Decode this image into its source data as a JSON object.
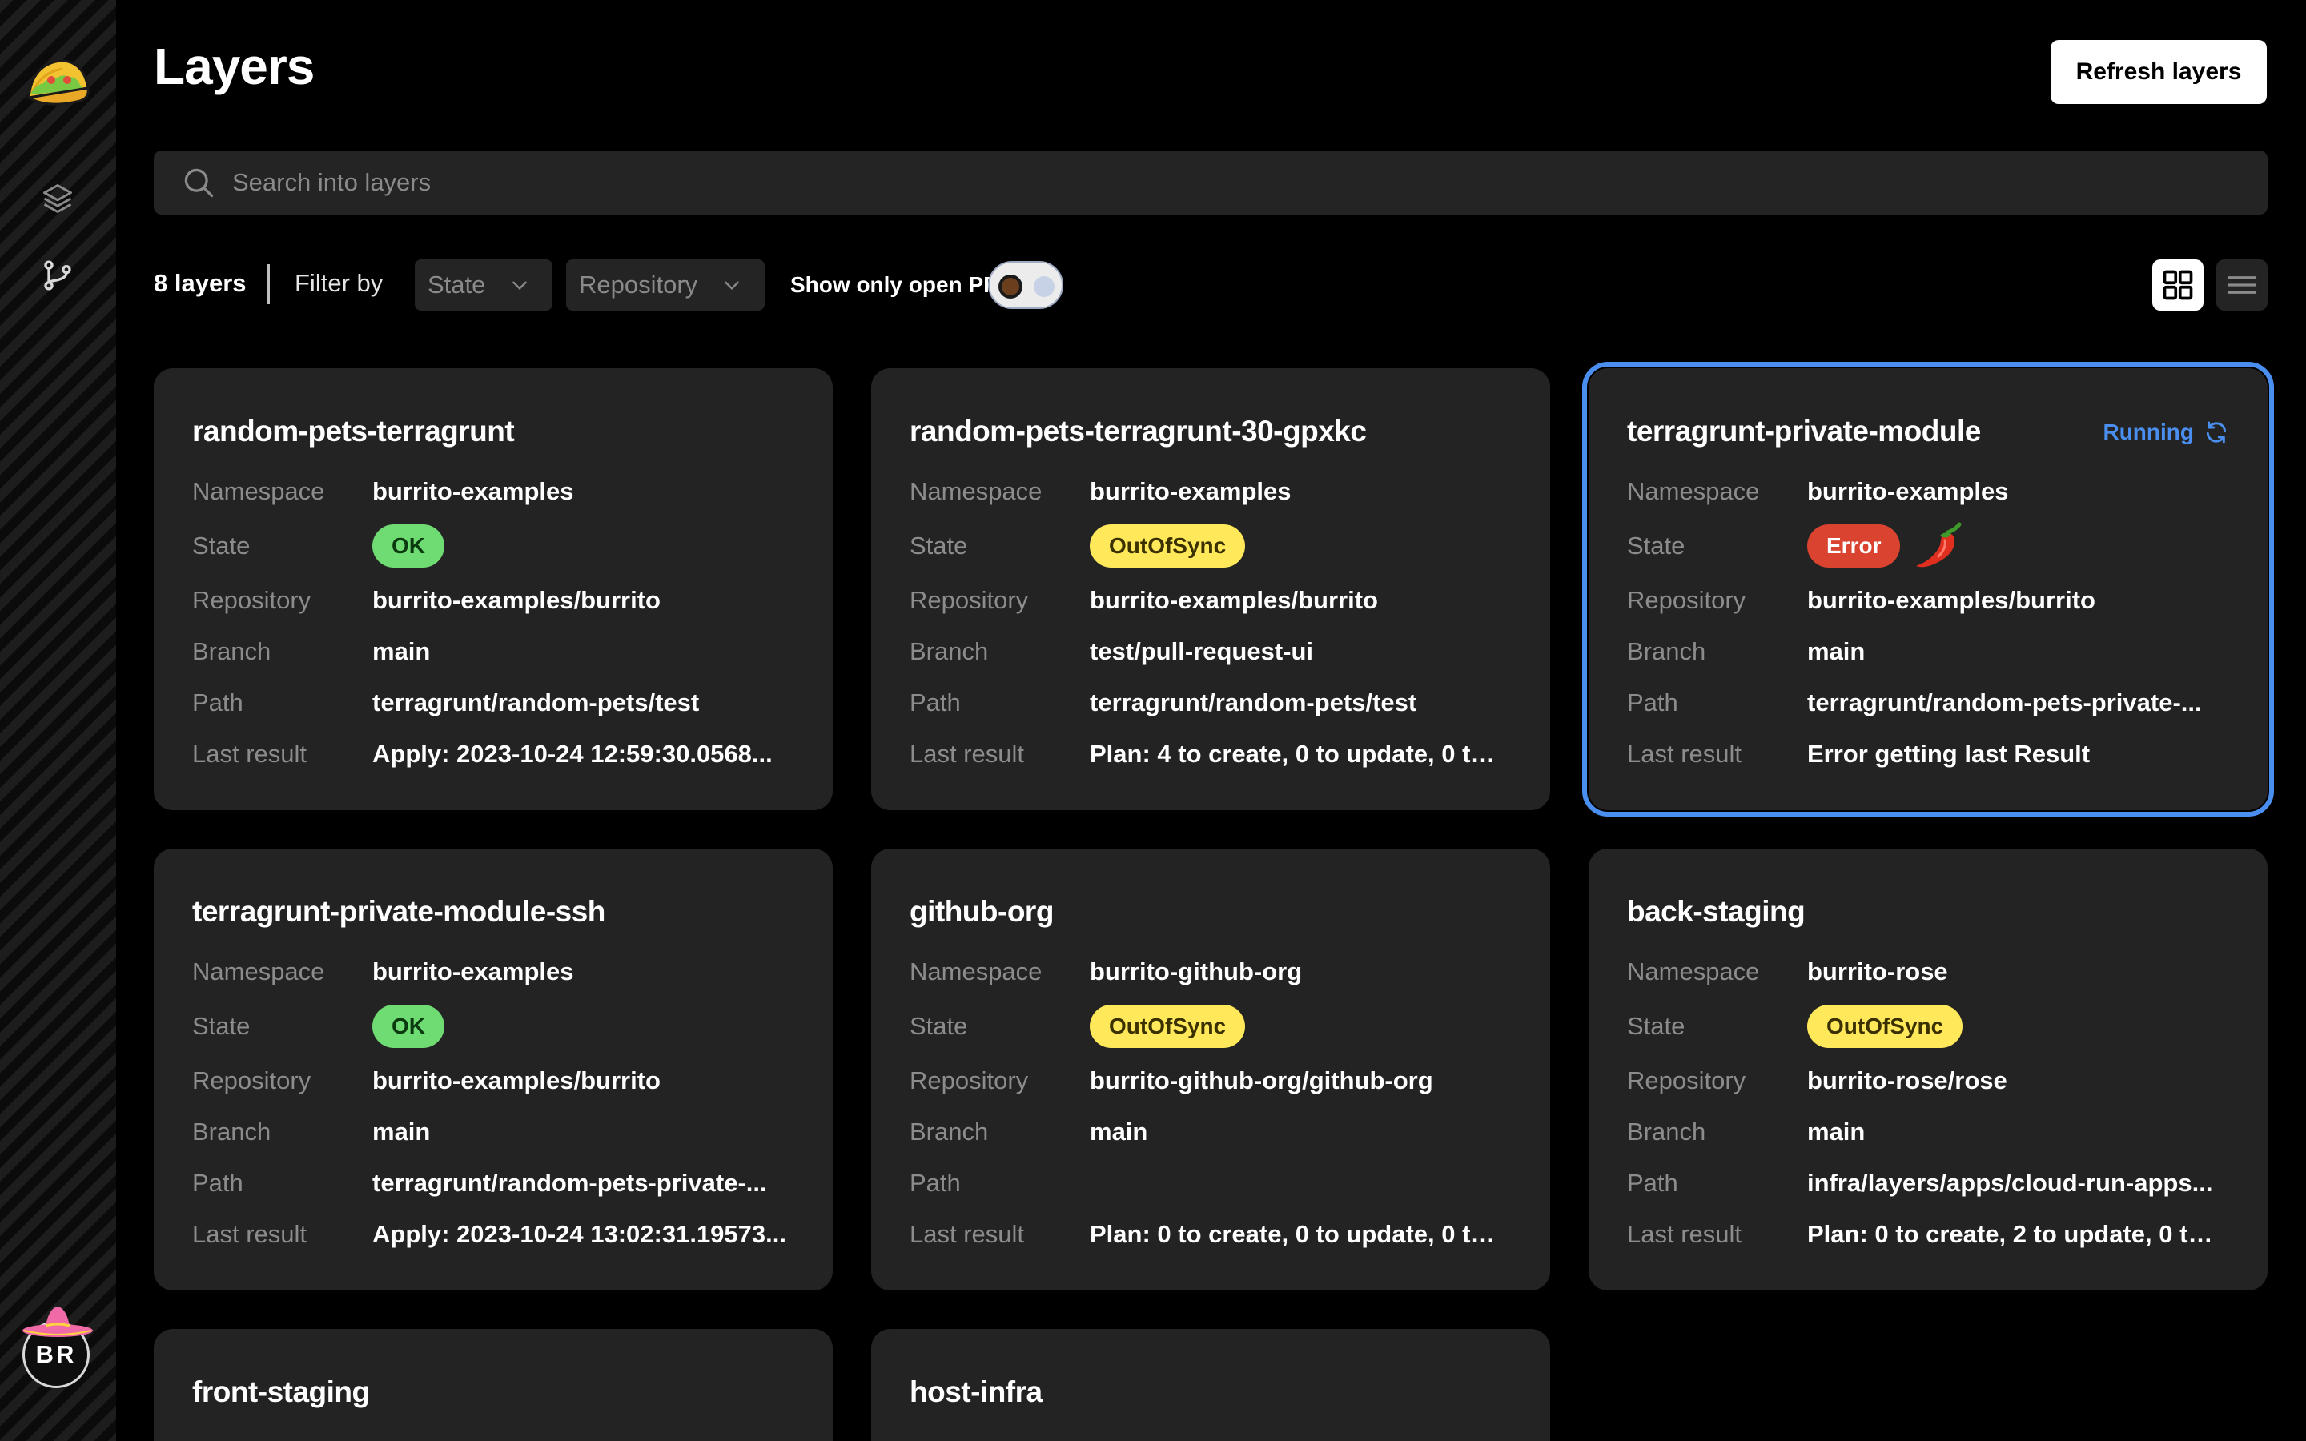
{
  "sidebar": {
    "logo_icon": "taco-icon",
    "nav": [
      {
        "icon": "layers-icon",
        "label": "Layers"
      },
      {
        "icon": "git-branch-icon",
        "label": "Pull requests"
      }
    ],
    "avatar_initials": "BR"
  },
  "header": {
    "title": "Layers",
    "refresh_label": "Refresh layers"
  },
  "search": {
    "placeholder": "Search into layers",
    "value": ""
  },
  "filters": {
    "count_label": "8 layers",
    "filter_by_label": "Filter by",
    "state_select": "State",
    "repository_select": "Repository",
    "open_pr_label": "Show only open PR",
    "open_pr_enabled": false,
    "view_mode": "grid"
  },
  "row_labels": {
    "namespace": "Namespace",
    "state": "State",
    "repository": "Repository",
    "branch": "Branch",
    "path": "Path",
    "last_result": "Last result"
  },
  "colors": {
    "ok": "#6fdb73",
    "out_of_sync": "#ffe95a",
    "error": "#d9432f",
    "accent": "#4a8ff0"
  },
  "cards": [
    {
      "title": "random-pets-terragrunt",
      "namespace": "burrito-examples",
      "state": "OK",
      "repository": "burrito-examples/burrito",
      "branch": "main",
      "path": "terragrunt/random-pets/test",
      "last_result": "Apply: 2023-10-24 12:59:30.0568..."
    },
    {
      "title": "random-pets-terragrunt-30-gpxkc",
      "namespace": "burrito-examples",
      "state": "OutOfSync",
      "repository": "burrito-examples/burrito",
      "branch": "test/pull-request-ui",
      "path": "terragrunt/random-pets/test",
      "last_result": "Plan: 4 to create, 0 to update, 0 to ..."
    },
    {
      "title": "terragrunt-private-module",
      "running_label": "Running",
      "namespace": "burrito-examples",
      "state": "Error",
      "repository": "burrito-examples/burrito",
      "branch": "main",
      "path": "terragrunt/random-pets-private-...",
      "last_result": "Error getting last Result"
    },
    {
      "title": "terragrunt-private-module-ssh",
      "namespace": "burrito-examples",
      "state": "OK",
      "repository": "burrito-examples/burrito",
      "branch": "main",
      "path": "terragrunt/random-pets-private-...",
      "last_result": "Apply: 2023-10-24 13:02:31.19573..."
    },
    {
      "title": "github-org",
      "namespace": "burrito-github-org",
      "state": "OutOfSync",
      "repository": "burrito-github-org/github-org",
      "branch": "main",
      "path": "",
      "last_result": "Plan: 0 to create, 0 to update, 0 to ..."
    },
    {
      "title": "back-staging",
      "namespace": "burrito-rose",
      "state": "OutOfSync",
      "repository": "burrito-rose/rose",
      "branch": "main",
      "path": "infra/layers/apps/cloud-run-apps...",
      "last_result": "Plan: 0 to create, 2 to update, 0 to ..."
    },
    {
      "title": "front-staging"
    },
    {
      "title": "host-infra"
    }
  ]
}
